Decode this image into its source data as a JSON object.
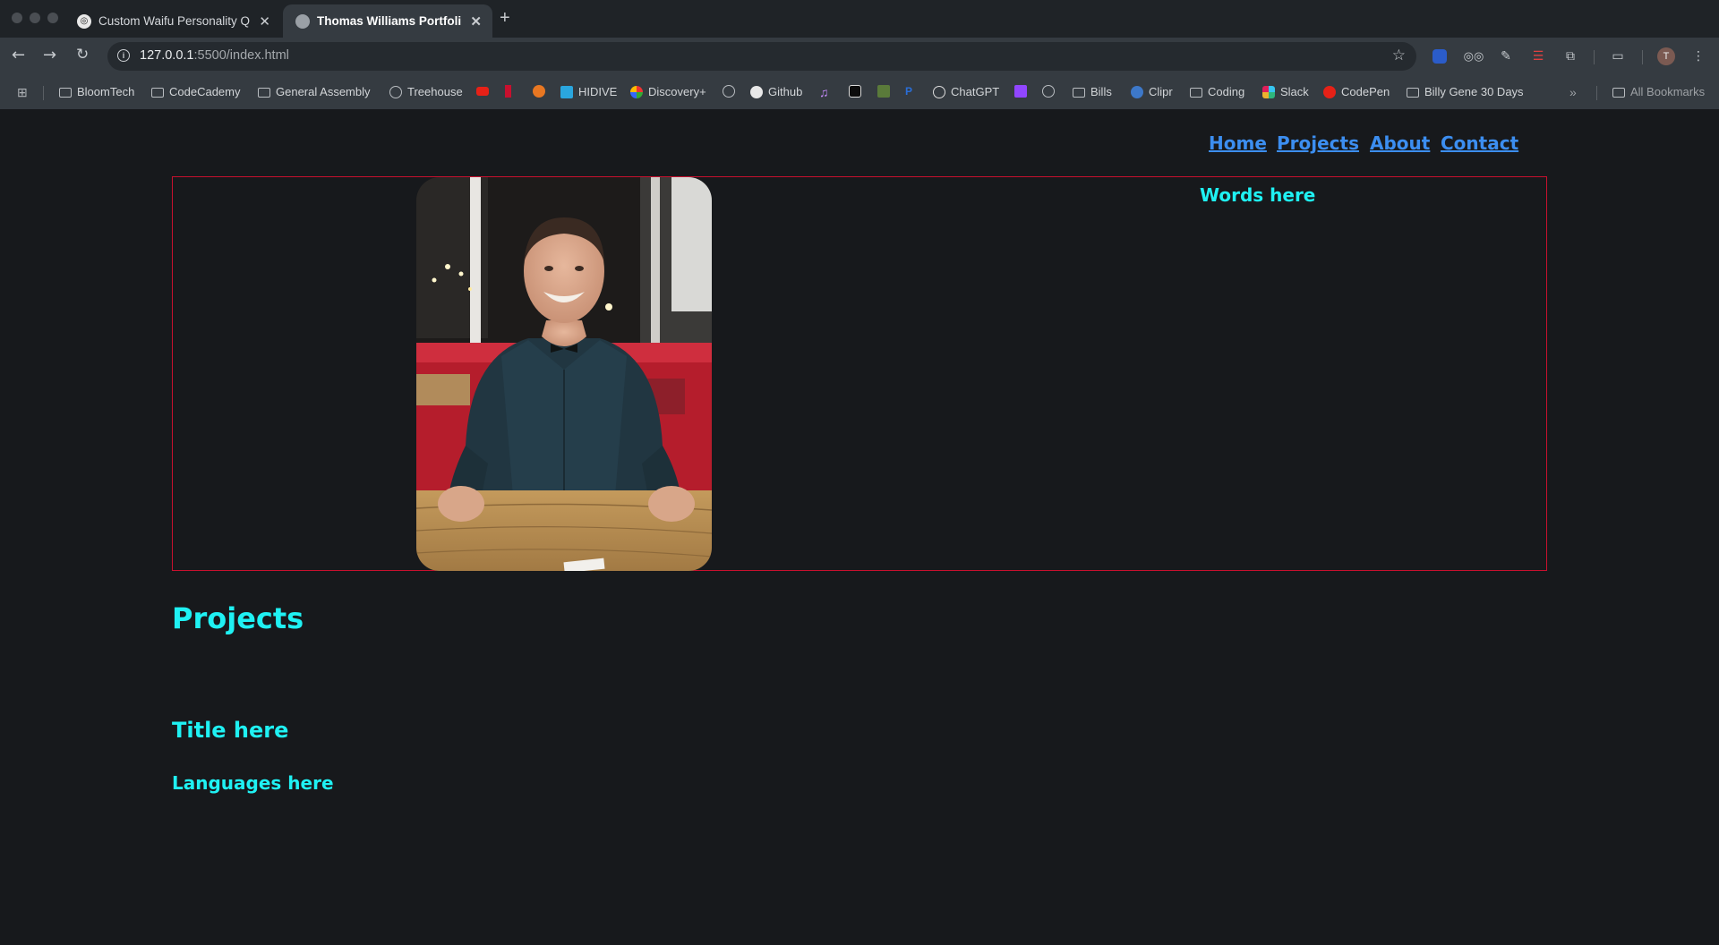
{
  "browser": {
    "tabs": [
      {
        "title": "Custom Waifu Personality Qu",
        "active": false
      },
      {
        "title": "Thomas Williams Portfolio",
        "active": true
      }
    ],
    "url_host": "127.0.0.1",
    "url_path": ":5500/index.html",
    "bookmarks": [
      {
        "label": "BloomTech",
        "icon": "folder-icon"
      },
      {
        "label": "CodeCademy",
        "icon": "folder-icon"
      },
      {
        "label": "General Assembly",
        "icon": "folder-icon"
      },
      {
        "label": "Treehouse",
        "icon": "globe-icon"
      },
      {
        "label": "",
        "icon": "youtube-icon"
      },
      {
        "label": "",
        "icon": "netflix-icon"
      },
      {
        "label": "",
        "icon": "crunchyroll-icon"
      },
      {
        "label": "HIDIVE",
        "icon": "hidive-icon"
      },
      {
        "label": "Discovery+",
        "icon": "discovery-icon"
      },
      {
        "label": "",
        "icon": "globe-icon"
      },
      {
        "label": "Github",
        "icon": "github-icon"
      },
      {
        "label": "",
        "icon": "music-icon"
      },
      {
        "label": "",
        "icon": "openai-icon"
      },
      {
        "label": "",
        "icon": "shopify-icon"
      },
      {
        "label": "",
        "icon": "paypal-icon"
      },
      {
        "label": "ChatGPT",
        "icon": "openai-icon"
      },
      {
        "label": "",
        "icon": "twitch-icon"
      },
      {
        "label": "",
        "icon": "globe-icon"
      },
      {
        "label": "Bills",
        "icon": "folder-icon"
      },
      {
        "label": "Clipr",
        "icon": "wordpress-icon"
      },
      {
        "label": "Coding",
        "icon": "folder-icon"
      },
      {
        "label": "Slack",
        "icon": "slack-icon"
      },
      {
        "label": "CodePen",
        "icon": "youtube-icon"
      },
      {
        "label": "Billy Gene 30 Days",
        "icon": "folder-icon"
      }
    ],
    "all_bookmarks": "All Bookmarks",
    "profile_initial": "T"
  },
  "site": {
    "nav": {
      "home": "Home",
      "projects": "Projects",
      "about": "About",
      "contact": "Contact"
    },
    "hero_text": "Words here",
    "projects_heading": "Projects",
    "project_title": "Title here",
    "project_languages": "Languages here"
  },
  "colors": {
    "accent_text": "#1ff1f3",
    "nav_link": "#3c8ef0",
    "hero_border": "#c8102e",
    "page_bg": "#17191c"
  }
}
